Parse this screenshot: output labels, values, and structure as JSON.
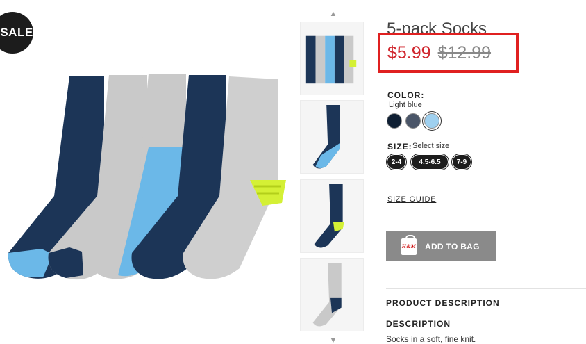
{
  "badge": {
    "label": "SALE"
  },
  "product": {
    "title": "5-pack Socks",
    "price_sale": "$5.99",
    "price_original": "$12.99"
  },
  "color": {
    "heading": "COLOR:",
    "selected": "Light blue",
    "swatches": [
      {
        "name": "dark-navy",
        "color": "#0f1f33"
      },
      {
        "name": "grey-blue",
        "color": "#4a5568"
      },
      {
        "name": "light-blue",
        "color": "#9fd0ef"
      }
    ]
  },
  "size": {
    "heading": "SIZE:",
    "prompt": "Select size",
    "options": [
      "2-4",
      "4.5-6.5",
      "7-9"
    ]
  },
  "links": {
    "size_guide": "SIZE GUIDE"
  },
  "actions": {
    "add_to_bag": "ADD TO BAG",
    "brand_mark": "H&M"
  },
  "sections": {
    "product_description": "PRODUCT DESCRIPTION",
    "description_heading": "DESCRIPTION",
    "description_text": "Socks in a soft, fine knit."
  },
  "colors": {
    "price_accent": "#d0262d",
    "highlight_border": "#e02020",
    "navy": "#1c3557",
    "light_grey": "#c9c9c9",
    "sky_blue": "#6bb8e8",
    "neon_yellow": "#d4f035"
  }
}
